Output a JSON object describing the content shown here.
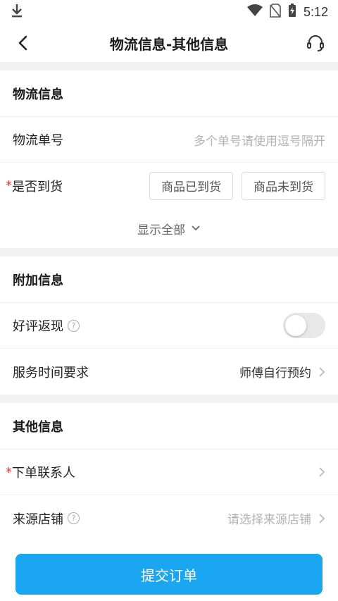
{
  "status": {
    "time": "5:12"
  },
  "nav": {
    "title": "物流信息-其他信息"
  },
  "logistics": {
    "section_title": "物流信息",
    "tracking_label": "物流单号",
    "tracking_placeholder": "多个单号请使用逗号隔开",
    "arrival_label": "是否到货",
    "required_mark": "*",
    "option_arrived": "商品已到货",
    "option_not_arrived": "商品未到货",
    "show_all": "显示全部"
  },
  "extra": {
    "section_title": "附加信息",
    "cashback_label": "好评返现",
    "cashback_enabled": false,
    "service_time_label": "服务时间要求",
    "service_time_value": "师傅自行预约"
  },
  "other": {
    "section_title": "其他信息",
    "contact_label": "下单联系人",
    "required_mark": "*",
    "store_label": "来源店铺",
    "store_placeholder": "请选择来源店铺"
  },
  "help_glyph": "?",
  "submit_label": "提交订单",
  "colors": {
    "accent": "#1aa6f0",
    "required": "#e53935"
  }
}
